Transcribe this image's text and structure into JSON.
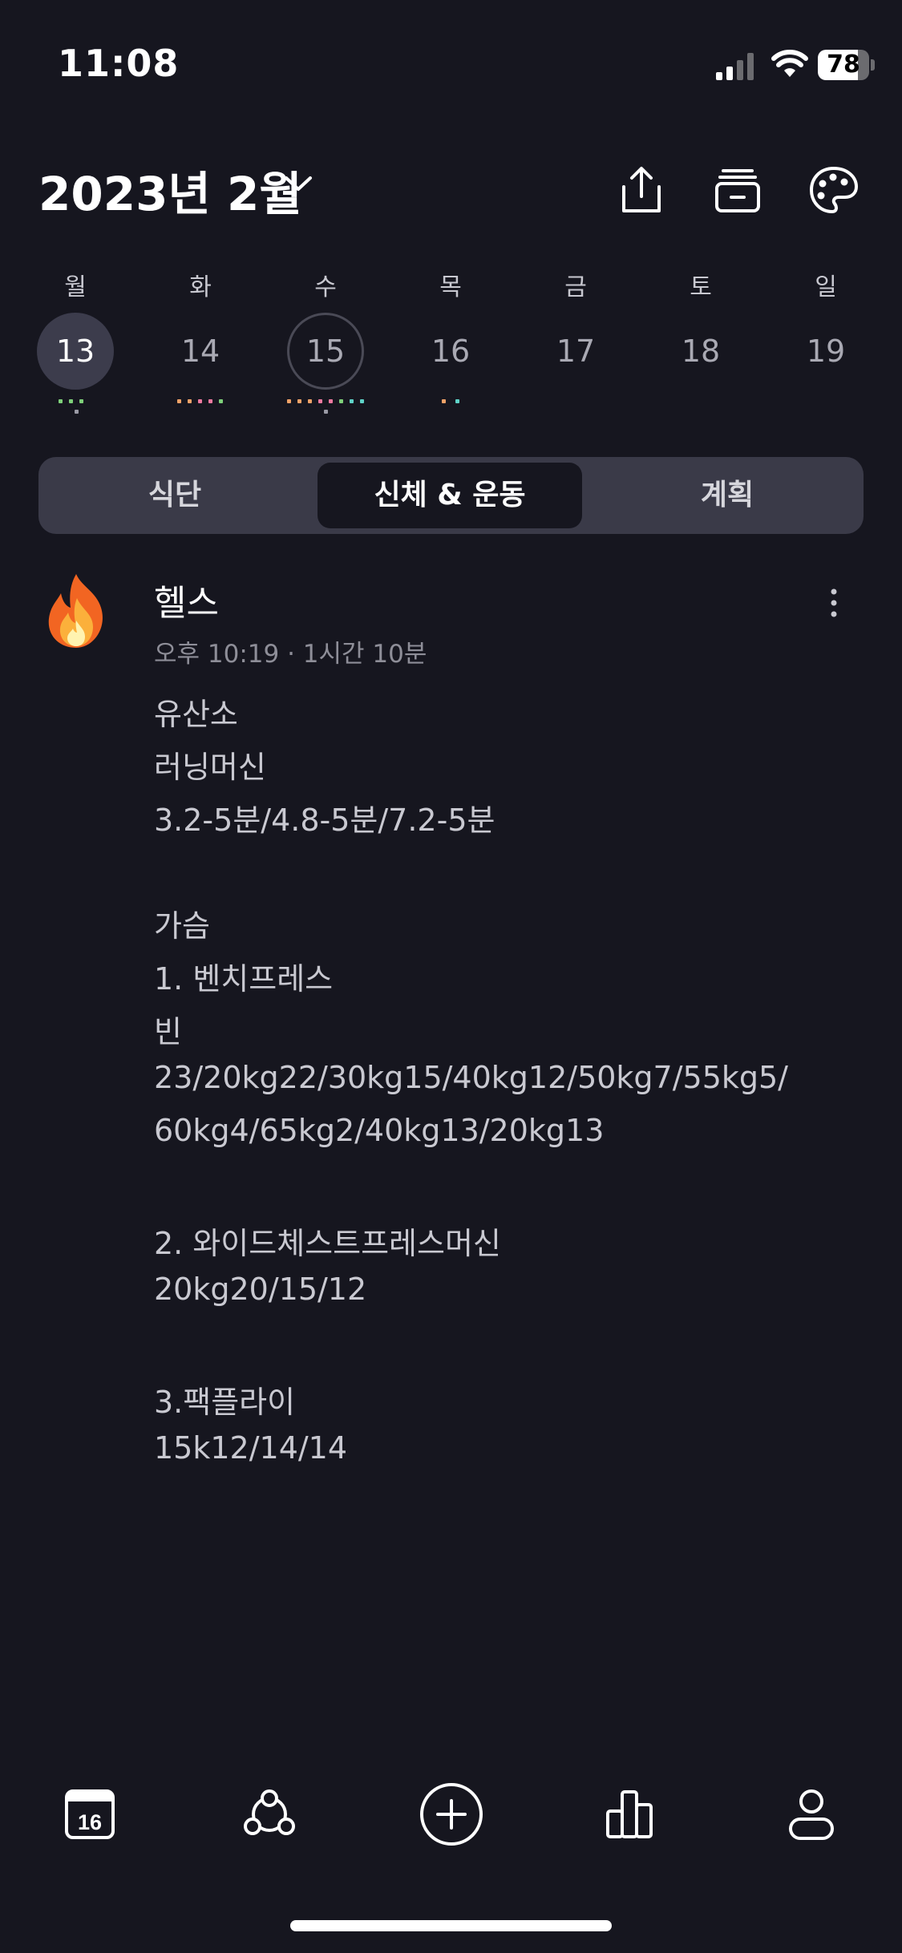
{
  "status_bar": {
    "time": "11:08",
    "battery_percent": "78",
    "battery_level": 0.78
  },
  "header": {
    "month_title": "2023년 2월"
  },
  "week": {
    "weekdays": [
      "월",
      "화",
      "수",
      "목",
      "금",
      "토",
      "일"
    ],
    "days": [
      "13",
      "14",
      "15",
      "16",
      "17",
      "18",
      "19"
    ],
    "selected_day": "13",
    "today_day": "15"
  },
  "tabs": [
    {
      "label": "식단"
    },
    {
      "label": "신체 & 운동",
      "active": true
    },
    {
      "label": "계획"
    }
  ],
  "entry": {
    "emoji": "fire-icon",
    "title": "헬스",
    "meta": "오후 10:19 · 1시간 10분",
    "lines": [
      "유산소",
      "러닝머신",
      "3.2-5분/4.8-5분/7.2-5분",
      "",
      "가슴",
      "1. 벤치프레스",
      "빈",
      "23/20kg22/30kg15/40kg12/50kg7/55kg5/",
      "60kg4/65kg2/40kg13/20kg13",
      "",
      "2. 와이드체스트프레스머신",
      "20kg20/15/12",
      "",
      "3.팩플라이",
      "15k12/14/14"
    ]
  },
  "bottom_nav": {
    "calendar_day": "16"
  },
  "colors": {
    "background": "#16161f",
    "segment_bg": "#3a3a48",
    "dot_green": "#7ed07a",
    "dot_orange": "#f0a268",
    "dot_pink": "#f07aa0",
    "dot_teal": "#5fd3c8",
    "dot_gray": "#9a9aa5"
  }
}
